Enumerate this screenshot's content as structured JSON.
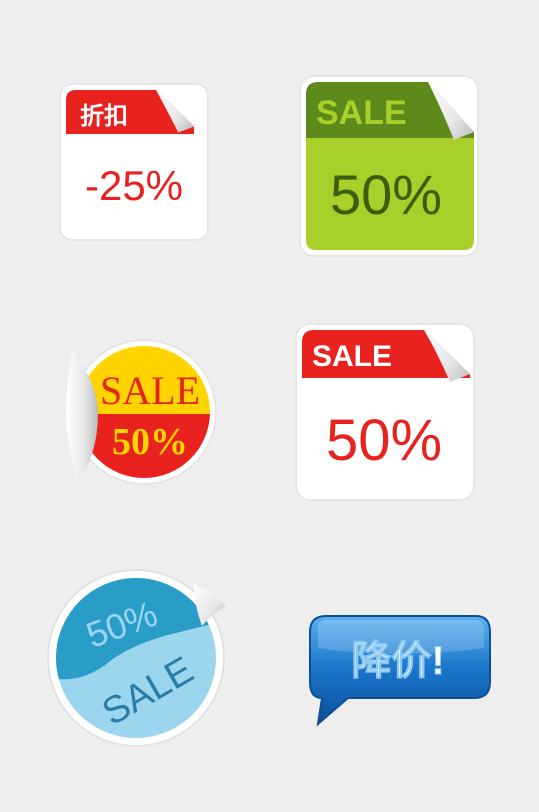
{
  "stickers": [
    {
      "id": "discount-tag",
      "header": "折扣",
      "value": "-25%"
    },
    {
      "id": "green-sale-tag",
      "header": "SALE",
      "value": "50%"
    },
    {
      "id": "round-yellow-red-badge",
      "top": "SALE",
      "bottom": "50%"
    },
    {
      "id": "red-white-sale-tag",
      "header": "SALE",
      "value": "50%"
    },
    {
      "id": "round-blue-badge",
      "top": "50%",
      "bottom": "SALE"
    },
    {
      "id": "price-drop-bubble",
      "text": "降价!"
    }
  ],
  "colors": {
    "background": "#eeeeee",
    "red": "#e8231f",
    "green_light": "#a9cf2a",
    "green_dark": "#5e8a1c",
    "yellow": "#ffd400",
    "blue_dark": "#2a9cc8",
    "blue_light": "#9cd6ee",
    "bubble_blue": "#1a74c9"
  }
}
